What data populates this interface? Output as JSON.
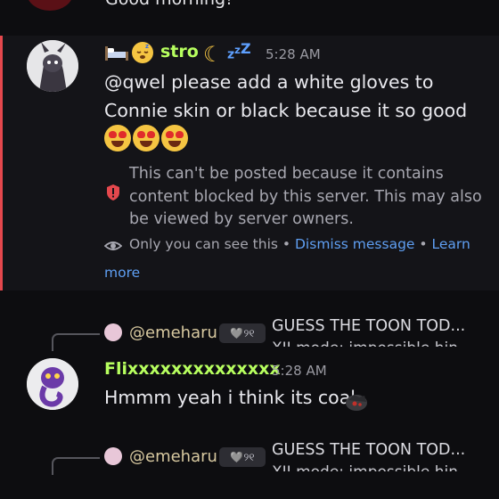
{
  "top_message": {
    "text": "Good morning!"
  },
  "blocked_message": {
    "author": "stro",
    "time": "5:28 AM",
    "content_line1": "@qwel please add a white gloves to",
    "content_line2": "Connie skin or black because it  so good",
    "blocked_notice": "This can't be posted because it contains content blocked by this server. This may also be viewed by server owners.",
    "visibility_note": "Only you can see this",
    "separator": "•",
    "dismiss_label": "Dismiss message",
    "learn_more_label1": "Learn",
    "learn_more_label2": "more",
    "icons": [
      "bed-icon",
      "sleeping-face-icon",
      "crescent-moon-icon",
      "zzz-icon",
      "heart-eyes-emoji-icon",
      "shield-icon",
      "eye-icon"
    ]
  },
  "reply1": {
    "reply_author": "@emeharu",
    "badge": "🩶୨୧",
    "reply_preview": "GUESS THE TOON TOD...",
    "reply_preview2": "XII mode: impossible hin",
    "author": "Flixxxxxxxxxxxxxx",
    "author_color": "#b7ff5f",
    "time": "5:28 AM",
    "content": "Hmmm yeah i think its coal"
  },
  "reply2": {
    "reply_author": "@emeharu",
    "badge": "🩶୨୧",
    "reply_preview": "GUESS THE TOON TOD...",
    "reply_preview2": "XII mode: impossible hin"
  },
  "colors": {
    "background": "#0d0d10",
    "blocked_bg": "#141418",
    "blocked_border": "#e5484d",
    "link": "#5f9ff2"
  }
}
